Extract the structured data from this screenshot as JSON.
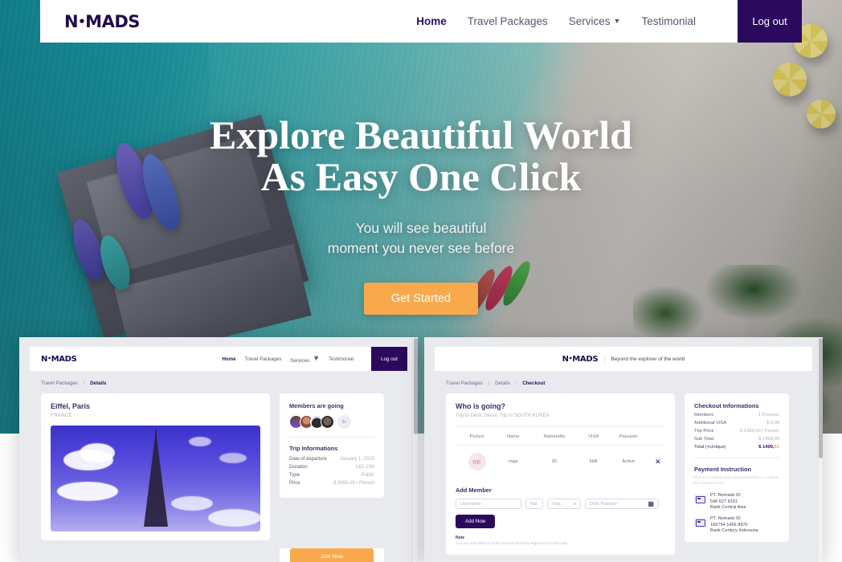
{
  "brand": {
    "name_prefix": "N",
    "name_dot": "•",
    "name_suffix": "MADS",
    "tagline": "Beyond the explorer of the world"
  },
  "nav": {
    "links": [
      {
        "label": "Home",
        "active": true
      },
      {
        "label": "Travel Packages",
        "active": false
      },
      {
        "label": "Services",
        "active": false,
        "caret": "▼"
      },
      {
        "label": "Testimonial",
        "active": false
      }
    ],
    "logout_label": "Log out"
  },
  "hero": {
    "title_line1": "Explore Beautiful World",
    "title_line2": "As Easy One Click",
    "sub_line1": "You will see beautiful",
    "sub_line2": "moment you never see before",
    "cta_label": "Get Started"
  },
  "details_panel": {
    "breadcrumb": {
      "first": "Travel Packages",
      "sep": "/",
      "current": "Details"
    },
    "package": {
      "title": "Eiffel, Paris",
      "country": "FRANCE"
    },
    "members_heading": "Members are going",
    "members_more": "9+",
    "trip_heading": "Trip Informations",
    "trip_rows": [
      {
        "key": "Date of departure",
        "value": "January 1, 2020"
      },
      {
        "key": "Duration",
        "value": "14D 13N"
      },
      {
        "key": "Type",
        "value": "Public"
      },
      {
        "key": "Price",
        "value": "$ 3459,00 / Person"
      }
    ],
    "join_label": "Join Now"
  },
  "checkout_panel": {
    "breadcrumb": {
      "first": "Travel Packages",
      "second": "Details",
      "sep": "/",
      "current": "Checkout"
    },
    "who_heading": "Who is going?",
    "who_sub": "Trip to Deok, Seoul, Trip to SOUTH KOREA",
    "table": {
      "headers": [
        "Picture",
        "Name",
        "Nationality",
        "VISA",
        "Passport",
        ""
      ],
      "rows": [
        {
          "initials": "RE",
          "name": "rega",
          "nationality": "ID",
          "visa": "N/A",
          "passport": "Active",
          "remove": "✕"
        }
      ]
    },
    "add_member": {
      "heading": "Add Member",
      "username_placeholder": "Username",
      "nat_placeholder": "Nat",
      "visa_placeholder": "Visa",
      "visa_caret": "♦",
      "passport_placeholder": "DOE Passpor",
      "passport_icon": "▦",
      "add_label": "Add Now"
    },
    "note": {
      "heading": "Note",
      "body": "You are only able to invite member that has registered in Nomads."
    },
    "checkout_info": {
      "heading": "Checkout Informations",
      "rows": [
        {
          "key": "Members",
          "value": "1 Persons"
        },
        {
          "key": "Additional VISA",
          "value": "$ 0,00"
        },
        {
          "key": "Trip Price",
          "value": "$ 1499,00 / Person"
        },
        {
          "key": "Sub Total",
          "value": "$ 1499,00"
        }
      ],
      "total_key": "Total (+Unique)",
      "total_main": "$ 1499,",
      "total_dec": "82"
    },
    "payment": {
      "heading": "Payment Instruction",
      "note": "Please complete your payment before to continue the wonderful trip",
      "accounts": [
        {
          "name": "PT. Nomads ID",
          "number": "546 627 8191",
          "bank": "Bank Central Asia"
        },
        {
          "name": "PT. Nomads ID",
          "number": "166754 1456 8976",
          "bank": "Bank Century Indonesia"
        }
      ]
    }
  },
  "colors": {
    "brand_purple": "#2b0a5e",
    "accent_orange": "#f9a94c",
    "panel_bg": "#e9eaee"
  }
}
